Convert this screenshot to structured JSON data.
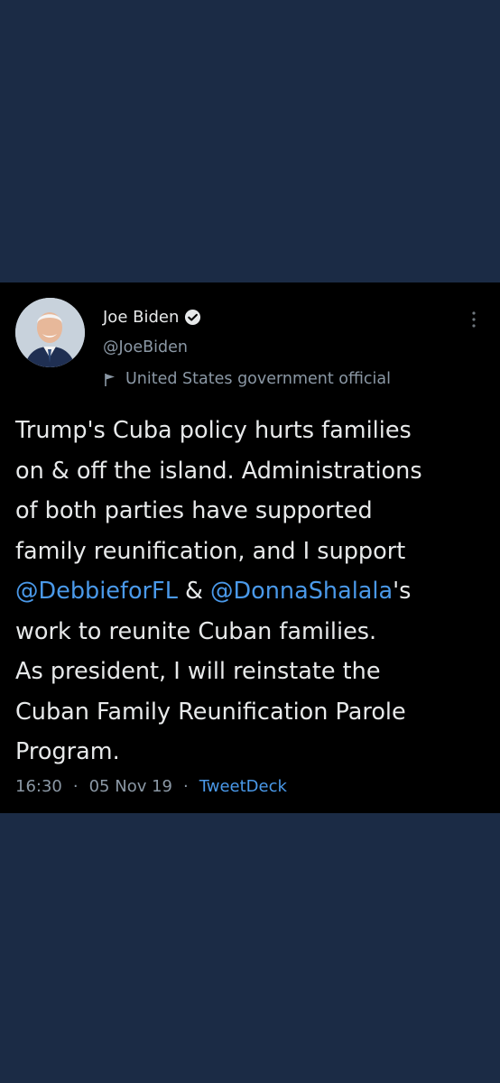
{
  "tweet": {
    "author_name": "Joe Biden",
    "author_handle": "@JoeBiden",
    "account_label": "United States government official",
    "icons": {
      "verified": "verified-badge-icon",
      "label": "flag-icon",
      "more": "more-vertical-icon"
    },
    "body": {
      "line1": "Trump's Cuba policy hurts families",
      "line2": "on & off the island. Administrations",
      "line3": "of both parties have supported",
      "line4": "family reunification, and I support",
      "mention1": "@DebbieforFL",
      "amp": " & ",
      "mention2": "@DonnaShalala",
      "line5_suffix": "'s",
      "line6": "work to reunite Cuban families.",
      "line7": "As president, I will reinstate the",
      "line8": "Cuban Family Reunification Parole",
      "line9": "Program."
    },
    "time": "16:30",
    "date": "05 Nov 19",
    "source": "TweetDeck",
    "separator": "·"
  },
  "colors": {
    "page_background": "#1b2b45",
    "tweet_background": "#000000",
    "text_primary": "#e7e9ea",
    "text_secondary": "#8b98a5",
    "link": "#4a99e9"
  }
}
